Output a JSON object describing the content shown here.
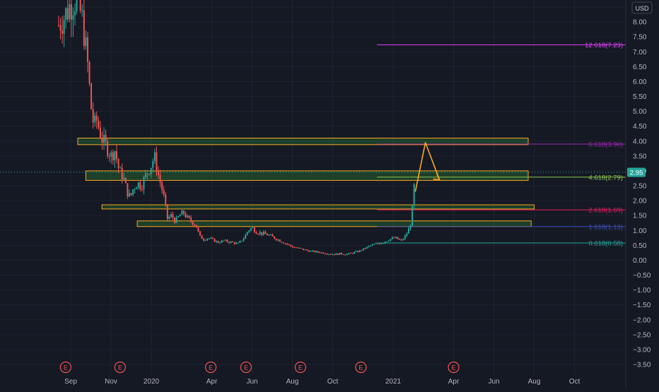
{
  "currency_badge": "USD",
  "price_tag": "2.95",
  "chart_data": {
    "type": "candlestick",
    "ylim": [
      -3.5,
      8.5
    ],
    "y_ticks": [
      "8.50",
      "8.00",
      "7.50",
      "7.00",
      "6.50",
      "6.00",
      "5.50",
      "5.00",
      "4.50",
      "4.00",
      "3.50",
      "3.00",
      "2.50",
      "2.00",
      "1.50",
      "1.00",
      "0.50",
      "0.00",
      "−0.50",
      "−1.00",
      "−1.50",
      "−2.00",
      "−2.50",
      "−3.00",
      "−3.50"
    ],
    "y_tick_values": [
      8.5,
      8.0,
      7.5,
      7.0,
      6.5,
      6.0,
      5.5,
      5.0,
      4.5,
      4.0,
      3.5,
      3.0,
      2.5,
      2.0,
      1.5,
      1.0,
      0.5,
      0.0,
      -0.5,
      -1.0,
      -1.5,
      -2.0,
      -2.5,
      -3.0,
      -3.5
    ],
    "x_ticks": [
      {
        "label": "Sep",
        "month": 0
      },
      {
        "label": "Nov",
        "month": 2
      },
      {
        "label": "2020",
        "month": 4
      },
      {
        "label": "Apr",
        "month": 7
      },
      {
        "label": "Jun",
        "month": 9
      },
      {
        "label": "Aug",
        "month": 11
      },
      {
        "label": "Oct",
        "month": 13
      },
      {
        "label": "2021",
        "month": 16
      },
      {
        "label": "Apr",
        "month": 19
      },
      {
        "label": "Jun",
        "month": 21
      },
      {
        "label": "Aug",
        "month": 23
      },
      {
        "label": "Oct",
        "month": 25
      }
    ],
    "earnings_markers": [
      {
        "label": "E",
        "month": -0.25
      },
      {
        "label": "E",
        "month": 2.45
      },
      {
        "label": "E",
        "month": 6.95
      },
      {
        "label": "E",
        "month": 8.7
      },
      {
        "label": "E",
        "month": 11.4
      },
      {
        "label": "E",
        "month": 14.4
      },
      {
        "label": "E",
        "month": 19.0
      }
    ],
    "price_path": [
      [
        -0.6,
        7.9
      ],
      [
        -0.3,
        8.2
      ],
      [
        0.0,
        8.6
      ],
      [
        0.3,
        8.8
      ],
      [
        0.6,
        8.0
      ],
      [
        0.85,
        6.5
      ],
      [
        1.0,
        5.2
      ],
      [
        1.15,
        4.5
      ],
      [
        1.3,
        4.7
      ],
      [
        1.45,
        4.3
      ],
      [
        1.6,
        4.0
      ],
      [
        1.8,
        3.8
      ],
      [
        2.0,
        3.5
      ],
      [
        2.2,
        3.7
      ],
      [
        2.4,
        3.0
      ],
      [
        2.6,
        2.8
      ],
      [
        2.8,
        2.3
      ],
      [
        2.95,
        2.1
      ],
      [
        3.1,
        2.4
      ],
      [
        3.3,
        2.6
      ],
      [
        3.5,
        2.5
      ],
      [
        3.7,
        2.8
      ],
      [
        3.85,
        3.0
      ],
      [
        4.0,
        3.2
      ],
      [
        4.15,
        3.5
      ],
      [
        4.3,
        3.0
      ],
      [
        4.45,
        2.6
      ],
      [
        4.6,
        2.2
      ],
      [
        4.8,
        1.4
      ],
      [
        5.0,
        1.5
      ],
      [
        5.2,
        1.3
      ],
      [
        5.4,
        1.5
      ],
      [
        5.6,
        1.6
      ],
      [
        5.8,
        1.4
      ],
      [
        6.0,
        1.3
      ],
      [
        6.2,
        1.2
      ],
      [
        6.4,
        0.8
      ],
      [
        6.6,
        0.7
      ],
      [
        6.8,
        0.75
      ],
      [
        7.0,
        0.7
      ],
      [
        7.3,
        0.6
      ],
      [
        7.6,
        0.65
      ],
      [
        8.0,
        0.6
      ],
      [
        8.3,
        0.55
      ],
      [
        8.6,
        0.75
      ],
      [
        8.8,
        1.0
      ],
      [
        9.0,
        1.1
      ],
      [
        9.2,
        0.95
      ],
      [
        9.5,
        0.9
      ],
      [
        9.8,
        0.85
      ],
      [
        10.1,
        0.75
      ],
      [
        10.4,
        0.65
      ],
      [
        10.7,
        0.55
      ],
      [
        11.0,
        0.45
      ],
      [
        11.3,
        0.4
      ],
      [
        11.6,
        0.35
      ],
      [
        11.9,
        0.3
      ],
      [
        12.2,
        0.28
      ],
      [
        12.5,
        0.25
      ],
      [
        12.8,
        0.22
      ],
      [
        13.1,
        0.2
      ],
      [
        13.4,
        0.22
      ],
      [
        13.7,
        0.2
      ],
      [
        14.0,
        0.25
      ],
      [
        14.3,
        0.3
      ],
      [
        14.6,
        0.4
      ],
      [
        14.9,
        0.5
      ],
      [
        15.2,
        0.55
      ],
      [
        15.5,
        0.6
      ],
      [
        15.8,
        0.7
      ],
      [
        16.1,
        0.75
      ],
      [
        16.4,
        0.65
      ],
      [
        16.6,
        0.8
      ],
      [
        16.75,
        1.0
      ],
      [
        16.9,
        1.3
      ],
      [
        17.1,
        2.95
      ]
    ],
    "fib_levels": [
      {
        "label": "0.618(0.58)",
        "value": 0.58,
        "color": "#26a69a",
        "start_month": 15.2
      },
      {
        "label": "1.618(1.13)",
        "value": 1.13,
        "color": "#3f51b5",
        "start_month": 15.2
      },
      {
        "label": "2.618(1.69)",
        "value": 1.69,
        "color": "#e91e63",
        "start_month": 15.2
      },
      {
        "label": "4.618(2.79)",
        "value": 2.79,
        "color": "#8bc34a",
        "start_month": 15.2
      },
      {
        "label": "6.618(3.90)",
        "value": 3.9,
        "color": "#9c27b0",
        "start_month": 15.2
      },
      {
        "label": "12.618(7.23)",
        "value": 7.23,
        "color": "#e040fb",
        "start_month": 15.2
      }
    ],
    "zones": [
      {
        "from_month": 0.35,
        "to_month": 22.7,
        "low": 3.88,
        "high": 4.1
      },
      {
        "from_month": 0.75,
        "to_month": 22.7,
        "low": 2.68,
        "high": 3.0
      },
      {
        "from_month": 1.55,
        "to_month": 23.0,
        "low": 1.72,
        "high": 1.86
      },
      {
        "from_month": 3.3,
        "to_month": 22.85,
        "low": 1.13,
        "high": 1.32
      }
    ],
    "arrow": [
      [
        17.1,
        2.3
      ],
      [
        17.6,
        3.95
      ],
      [
        18.3,
        2.7
      ]
    ],
    "colors": {
      "up": "#26a69a",
      "down": "#ef5350",
      "zone_fill": "#2e7d32",
      "zone_border": "#f9a825",
      "arrow": "#f9a825",
      "grid": "#1f2330",
      "price_line": "#26a69a"
    }
  }
}
